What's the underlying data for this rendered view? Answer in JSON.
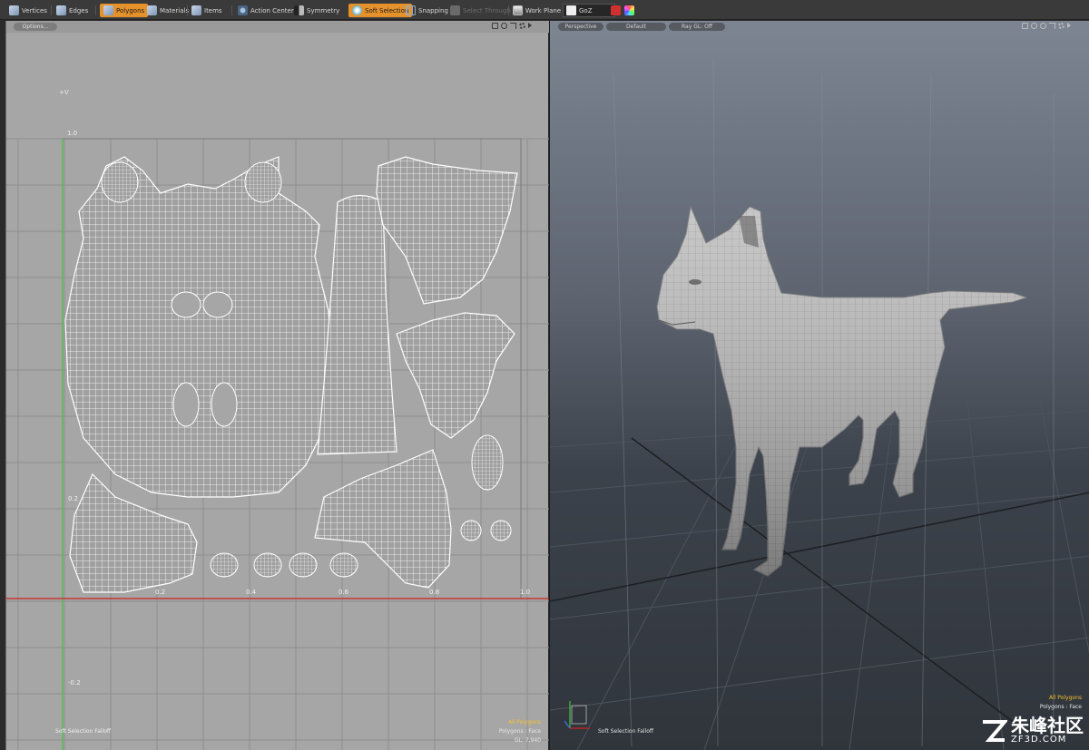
{
  "toolbar": {
    "items": [
      {
        "label": "Vertices",
        "icon": "cube-icon"
      },
      {
        "label": "Edges",
        "icon": "cube-icon"
      },
      {
        "label": "Polygons",
        "icon": "cube-icon"
      },
      {
        "label": "Materials",
        "icon": "cube-icon"
      },
      {
        "label": "Items",
        "icon": "cube-icon"
      },
      {
        "label": "Action Center",
        "icon": "action-center-icon"
      },
      {
        "label": "Symmetry",
        "icon": "symmetry-icon"
      },
      {
        "label": "Soft Selection",
        "icon": "soft-selection-icon"
      },
      {
        "label": "Snapping",
        "icon": "snapping-icon"
      },
      {
        "label": "Select Through",
        "icon": "select-through-icon"
      },
      {
        "label": "Work Plane",
        "icon": "work-plane-icon"
      },
      {
        "label": "GoZ",
        "icon": "goz-icon"
      }
    ],
    "active_mode": "Polygons",
    "active_toggle": "Soft Selection",
    "accent_color": "#e6922c"
  },
  "uv_view": {
    "options_label": "Options...",
    "v_axis_label": "+V",
    "tick_labels": {
      "top": "1.0",
      "left_mid": "0.2",
      "left_neg": "-0.2",
      "bottom_1": "0.2",
      "bottom_2": "0.4",
      "bottom_3": "0.6",
      "bottom_4": "0.8",
      "bottom_5": "1.0"
    },
    "footer_left": "Soft Selection Falloff",
    "status": {
      "line1": "All Polygons",
      "line2": "Polygons : Face",
      "line3": "GL: 7,940"
    },
    "background": "#a6a6a6",
    "v_axis_color": "#3ec43e",
    "u_axis_color": "#d02020"
  },
  "view3d": {
    "camera_label": "Perspective",
    "shading_label": "Default",
    "raygl_label": "Ray GL: Off",
    "footer_left": "Soft Selection Falloff",
    "status": {
      "line1": "All Polygons",
      "line2": "Polygons : Face"
    }
  },
  "watermark": {
    "text": "朱峰社区",
    "sub": "ZF3D.COM"
  }
}
